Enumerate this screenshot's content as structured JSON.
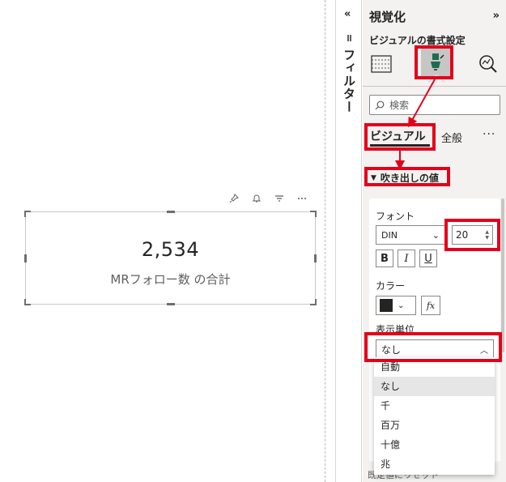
{
  "card": {
    "value": "2,534",
    "label": "MRフォロー数 の合計"
  },
  "visual_header_icons": [
    "pin-icon",
    "bell-icon",
    "filter-icon",
    "more-icon"
  ],
  "filters": {
    "collapse": "«",
    "title": "フィルター"
  },
  "visualizations": {
    "title": "視覚化",
    "expand": "»",
    "subtitle": "ビジュアルの書式設定",
    "search_placeholder": "検索",
    "tabs": {
      "visual": "ビジュアル",
      "general": "全般",
      "more": "···"
    },
    "section_title": "吹き出しの値",
    "font": {
      "label": "フォント",
      "family": "DIN",
      "size": "20"
    },
    "format_buttons": {
      "bold": "B",
      "italic": "I",
      "underline": "U"
    },
    "color": {
      "label": "カラー",
      "value": "#252423",
      "fx": "fx"
    },
    "display_units": {
      "label": "表示単位",
      "value": "なし",
      "options": [
        "自動",
        "なし",
        "千",
        "百万",
        "十億",
        "兆"
      ],
      "selected": "なし"
    },
    "behind_text": "既定値にリセット"
  },
  "colors": {
    "highlight": "#e3001b",
    "pane_bg": "#f3f2f1",
    "text": "#252423"
  }
}
